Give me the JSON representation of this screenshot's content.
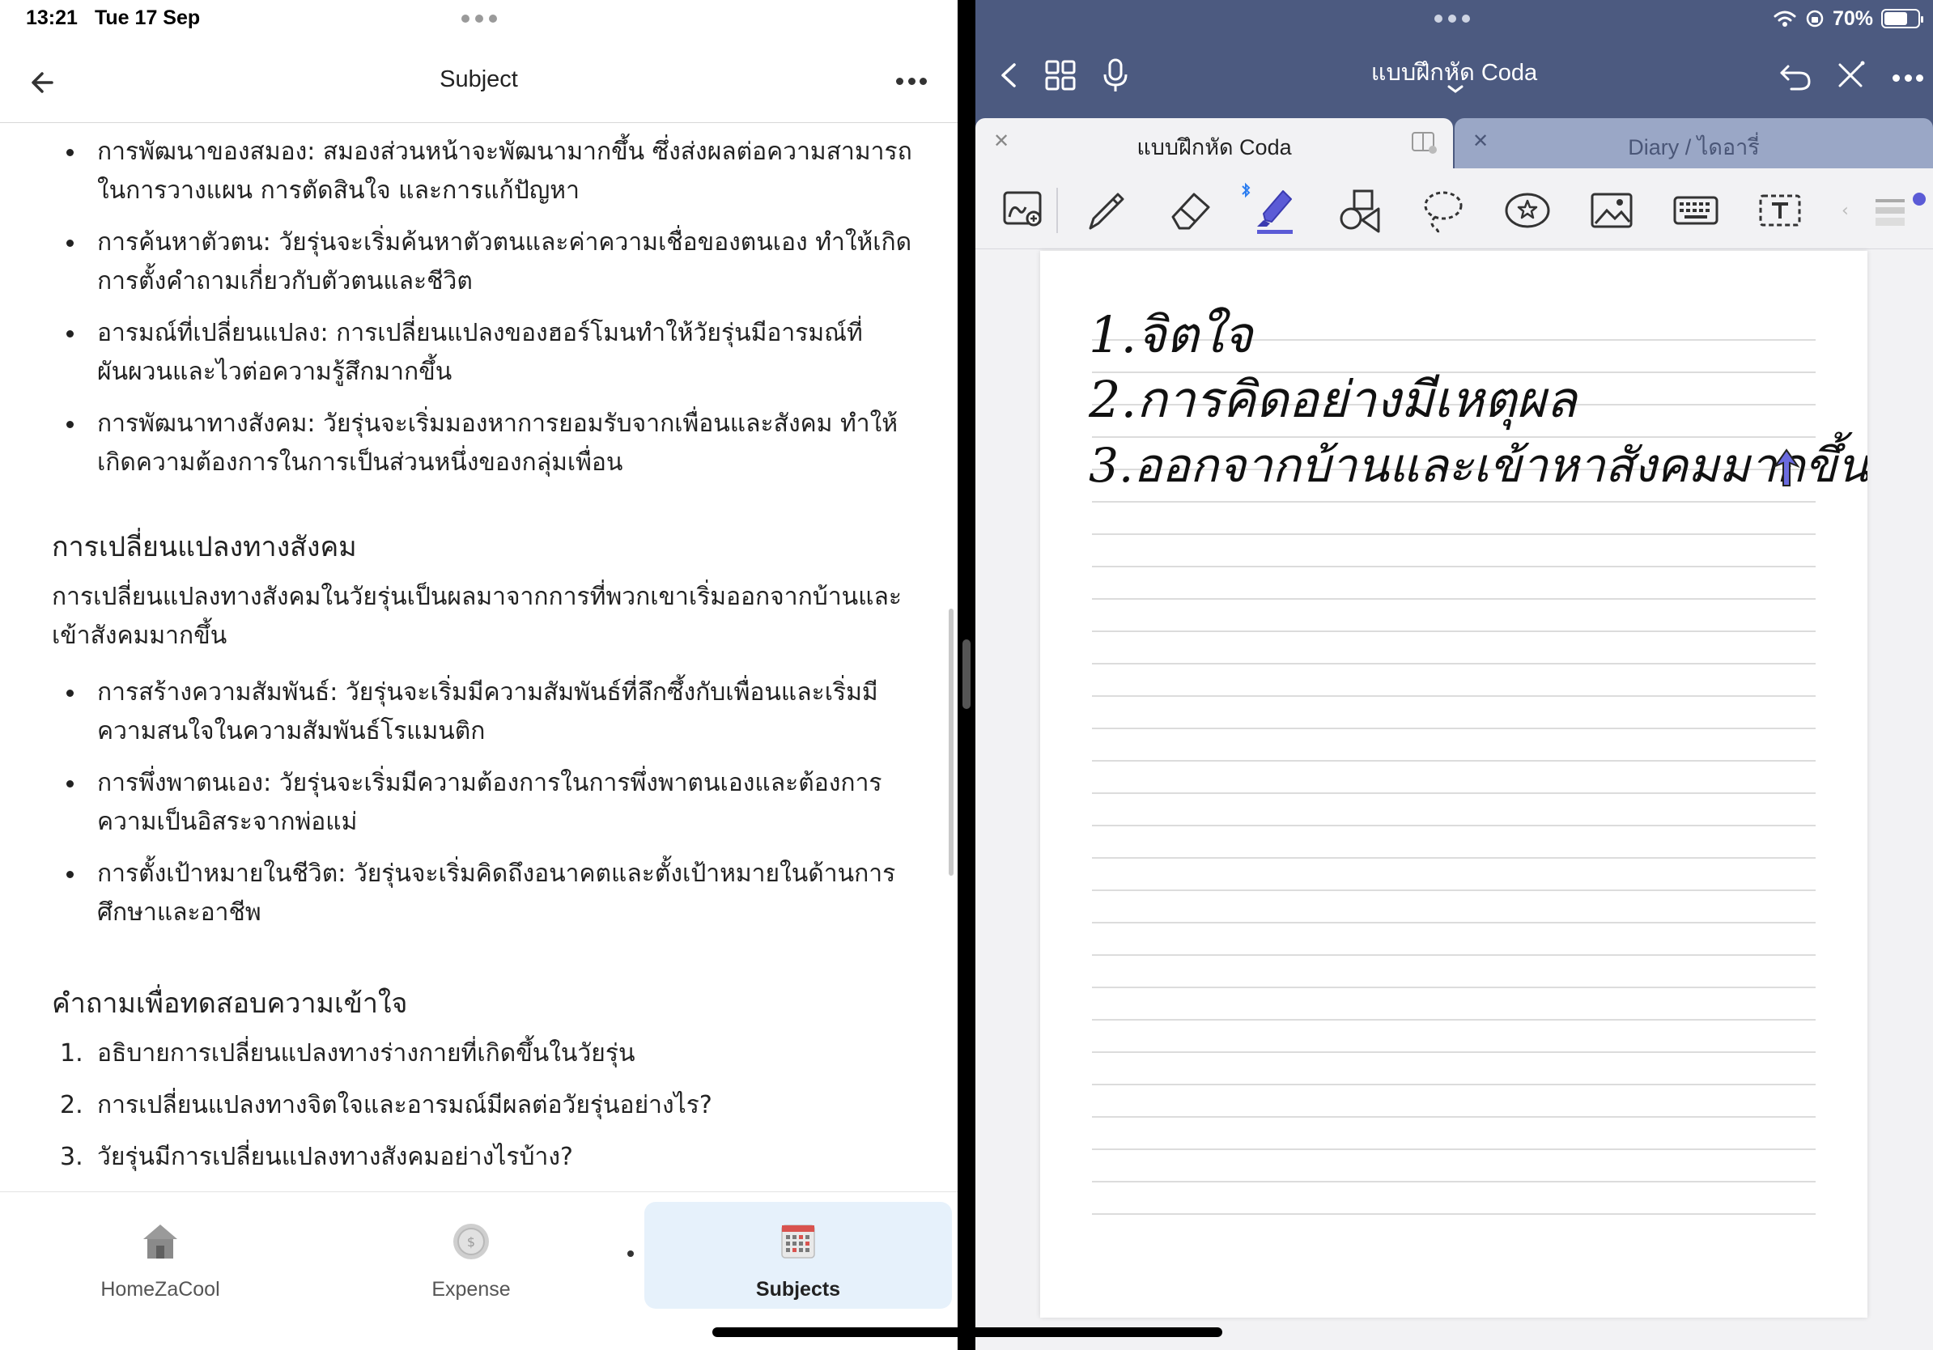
{
  "status": {
    "time": "13:21",
    "date": "Tue 17 Sep",
    "battery": "70%",
    "battery_level": 0.7
  },
  "left_app": {
    "nav_title": "Subject",
    "sections": {
      "bullets1": [
        "การพัฒนาของสมอง: สมองส่วนหน้าจะพัฒนามากขึ้น ซึ่งส่งผลต่อความสามารถในการวางแผน การตัดสินใจ และการแก้ปัญหา",
        "การค้นหาตัวตน: วัยรุ่นจะเริ่มค้นหาตัวตนและค่าความเชื่อของตนเอง ทำให้เกิดการตั้งคำถามเกี่ยวกับตัวตนและชีวิต",
        "อารมณ์ที่เปลี่ยนแปลง: การเปลี่ยนแปลงของฮอร์โมนทำให้วัยรุ่นมีอารมณ์ที่ผันผวนและไวต่อความรู้สึกมากขึ้น",
        "การพัฒนาทางสังคม: วัยรุ่นจะเริ่มมองหาการยอมรับจากเพื่อนและสังคม ทำให้เกิดความต้องการในการเป็นส่วนหนึ่งของกลุ่มเพื่อน"
      ],
      "heading_social": "การเปลี่ยนแปลงทางสังคม",
      "social_para": "การเปลี่ยนแปลงทางสังคมในวัยรุ่นเป็นผลมาจากการที่พวกเขาเริ่มออกจากบ้านและเข้าสังคมมากขึ้น",
      "bullets2": [
        "การสร้างความสัมพันธ์: วัยรุ่นจะเริ่มมีความสัมพันธ์ที่ลึกซึ้งกับเพื่อนและเริ่มมีความสนใจในความสัมพันธ์โรแมนติก",
        "การพึ่งพาตนเอง: วัยรุ่นจะเริ่มมีความต้องการในการพึ่งพาตนเองและต้องการความเป็นอิสระจากพ่อแม่",
        "การตั้งเป้าหมายในชีวิต: วัยรุ่นจะเริ่มคิดถึงอนาคตและตั้งเป้าหมายในด้านการศึกษาและอาชีพ"
      ],
      "heading_quiz": "คำถามเพื่อทดสอบความเข้าใจ",
      "quiz": [
        {
          "num": "1.",
          "text": "อธิบายการเปลี่ยนแปลงทางร่างกายที่เกิดขึ้นในวัยรุ่น"
        },
        {
          "num": "2.",
          "text": "การเปลี่ยนแปลงทางจิตใจและอารมณ์มีผลต่อวัยรุ่นอย่างไร?"
        },
        {
          "num": "3.",
          "text": "วัยรุ่นมีการเปลี่ยนแปลงทางสังคมอย่างไรบ้าง?"
        }
      ]
    },
    "tabs": [
      {
        "label": "HomeZaCool",
        "icon": "house-icon"
      },
      {
        "label": "Expense",
        "icon": "coin-icon"
      },
      {
        "label": "Subjects",
        "icon": "calendar-grid-icon",
        "active": true
      }
    ]
  },
  "right_app": {
    "doc_title": "แบบฝึกหัด Coda",
    "doc_tabs": [
      {
        "label": "แบบฝึกหัด Coda",
        "active": true
      },
      {
        "label": "Diary / ไดอารี่",
        "active": false
      }
    ],
    "tools": [
      "lasso-zoom-icon",
      "pen-icon",
      "eraser-icon",
      "highlighter-icon",
      "shapes-icon",
      "lasso-icon",
      "sticker-icon",
      "image-icon",
      "keyboard-icon",
      "text-box-icon"
    ],
    "handwriting": [
      "1.จิตใจ",
      "2.การคิดอย่างมีเหตุผล",
      "3.ออกจากบ้านและเข้าหาสังคมมากขึ้น"
    ],
    "highlighter_color": "#5b5bd6",
    "header_color": "#4c5a80"
  }
}
